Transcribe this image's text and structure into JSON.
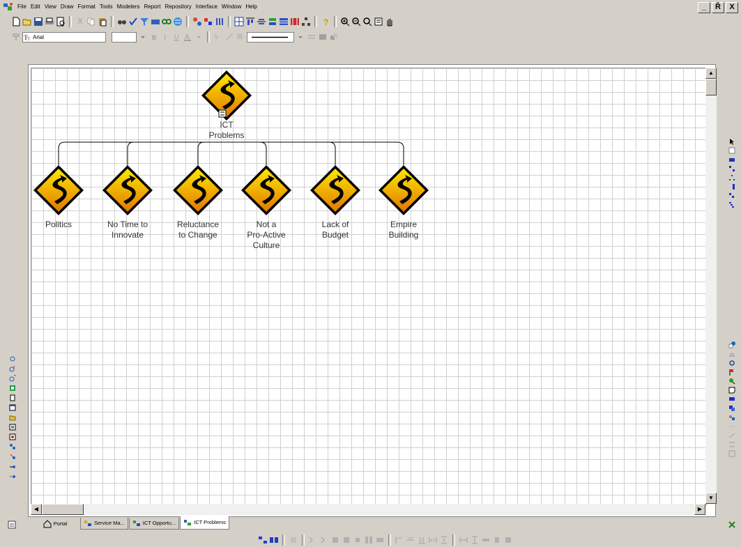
{
  "menu": {
    "items": [
      "File",
      "Edit",
      "View",
      "Draw",
      "Format",
      "Tools",
      "Modelers",
      "Report",
      "Repository",
      "Interface",
      "Window",
      "Help"
    ]
  },
  "window_controls": {
    "minimize": "_",
    "restore": "Ř",
    "close": "X"
  },
  "format_toolbar": {
    "font_name": "Arial"
  },
  "diagram": {
    "root": {
      "label_line1": "ICT",
      "label_line2": "Problems"
    },
    "children": [
      {
        "lines": [
          "Politics"
        ]
      },
      {
        "lines": [
          "No Time to",
          "Innovate"
        ]
      },
      {
        "lines": [
          "Reluctance",
          "to Change"
        ]
      },
      {
        "lines": [
          "Not a",
          "Pro-Active",
          "Culture"
        ]
      },
      {
        "lines": [
          "Lack of",
          "Budget"
        ]
      },
      {
        "lines": [
          "Empire",
          "Building"
        ]
      }
    ]
  },
  "tabs": [
    {
      "label": "Portal",
      "icon": "home-icon"
    },
    {
      "label": "Service Ma...",
      "icon": "service-model-icon"
    },
    {
      "label": "ICT Opportu...",
      "icon": "opportunity-model-icon"
    },
    {
      "label": "ICT Problems",
      "icon": "problems-model-icon",
      "active": true
    }
  ],
  "colors": {
    "sign_gradient_top": "#ffe000",
    "sign_gradient_bottom": "#e08000",
    "sign_border": "#000000",
    "grid_line": "#d0d0d0",
    "chrome": "#d4d0c8"
  }
}
